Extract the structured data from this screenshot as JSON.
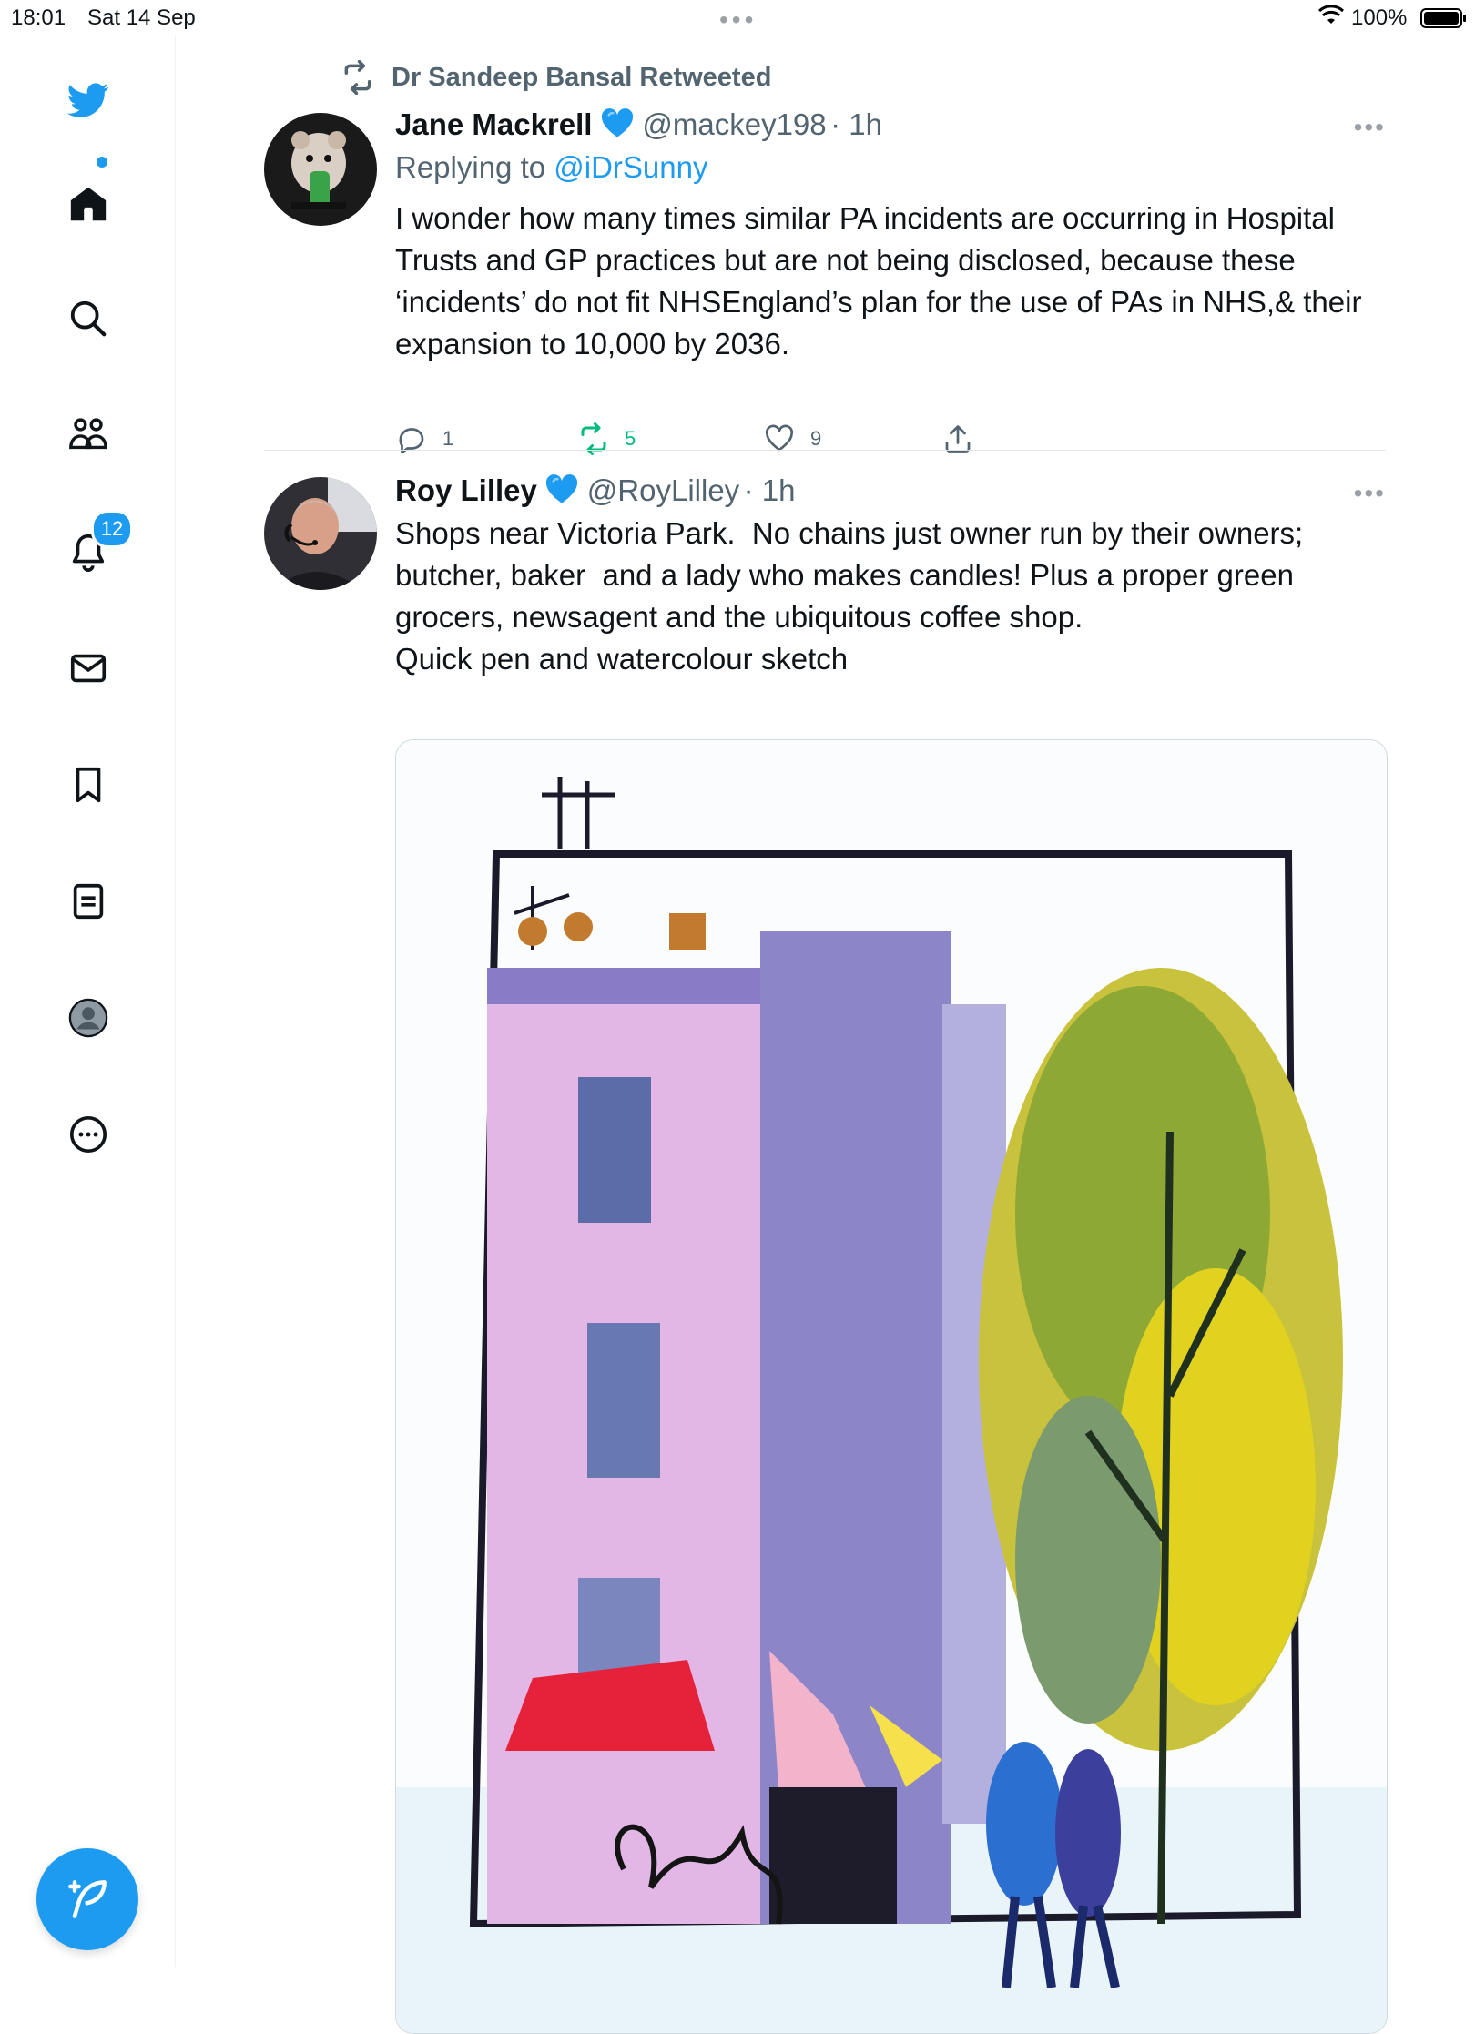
{
  "status_bar": {
    "time": "18:01",
    "date": "Sat 14 Sep",
    "battery": "100%"
  },
  "sidebar": {
    "items": [
      {
        "name": "twitter-logo-icon"
      },
      {
        "name": "home-icon"
      },
      {
        "name": "search-icon"
      },
      {
        "name": "communities-icon"
      },
      {
        "name": "notifications-icon",
        "badge": "12"
      },
      {
        "name": "messages-icon"
      },
      {
        "name": "bookmarks-icon"
      },
      {
        "name": "lists-icon"
      },
      {
        "name": "profile-icon"
      },
      {
        "name": "more-icon"
      }
    ],
    "notifications_badge": "12"
  },
  "feed": {
    "tweets": [
      {
        "retweeted_by": "Dr Sandeep Bansal Retweeted",
        "name": "Jane Mackrell",
        "handle": "@mackey198",
        "time": "· 1h",
        "replying_prefix": "Replying to ",
        "replying_to": "@iDrSunny",
        "text": "I wonder how many times similar PA incidents are occurring in Hospital Trusts and GP practices but are not being disclosed, because these ‘incidents’ do not fit NHSEngland’s plan for the use of PAs in NHS,& their expansion to 10,000 by 2036.",
        "replies": "1",
        "retweets": "5",
        "likes": "9"
      },
      {
        "name": "Roy Lilley",
        "handle": "@RoyLilley",
        "time": "· 1h",
        "text": "Shops near Victoria Park.  No chains just owner run by their owners; butcher, baker  and a lady who makes candles! Plus a proper green grocers, newsagent and the ubiquitous coffee shop.\nQuick pen and watercolour sketch"
      }
    ]
  },
  "colors": {
    "accent": "#1d9bf0",
    "retweet_green": "#00ba7c",
    "muted": "#536471"
  }
}
